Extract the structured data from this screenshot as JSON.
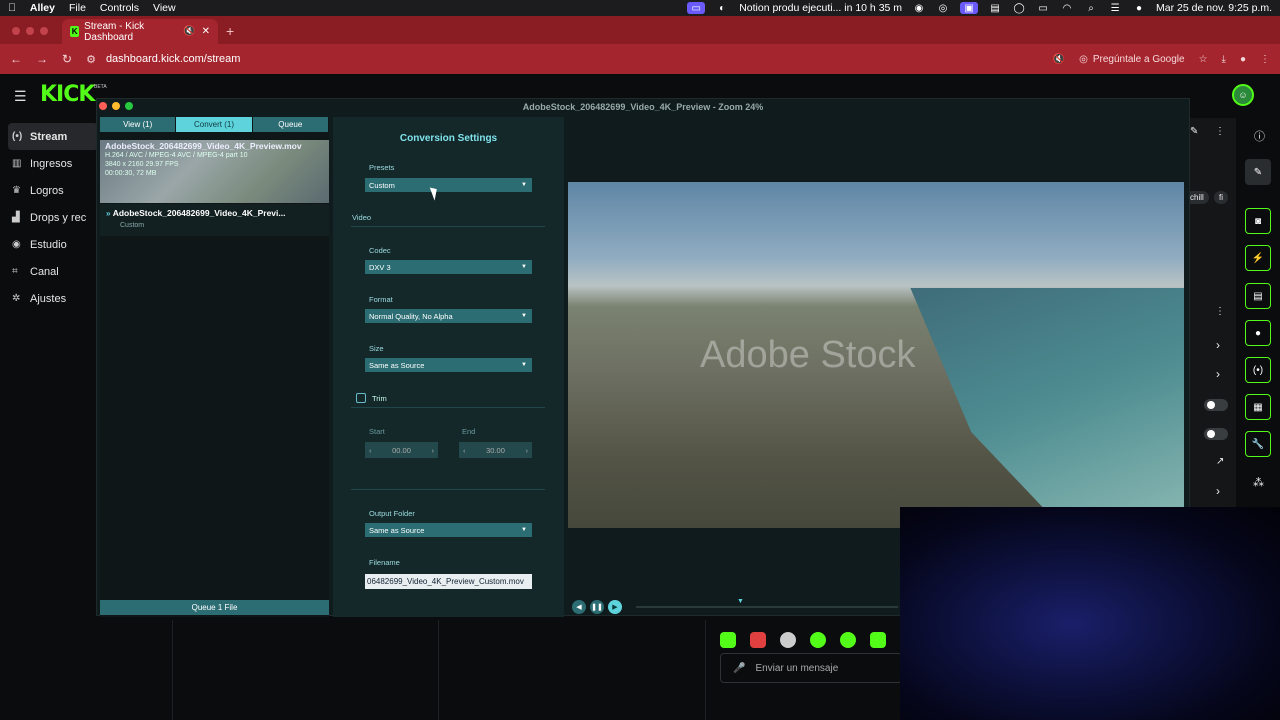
{
  "menubar": {
    "app": "Alley",
    "items": [
      "File",
      "Controls",
      "View"
    ],
    "notion": "Notion produ ejecuti... in 10 h 35 m",
    "datetime": "Mar 25 de nov.  9:25 p.m."
  },
  "browser": {
    "tab_title": "Stream - Kick Dashboard",
    "url": "dashboard.kick.com/stream",
    "google_pill": "Pregúntale a Google"
  },
  "kick": {
    "logo": "KICK",
    "beta": "BETA",
    "nav": [
      {
        "label": "Stream",
        "icon": "broadcast-icon",
        "active": true
      },
      {
        "label": "Ingresos",
        "icon": "chart-icon"
      },
      {
        "label": "Logros",
        "icon": "trophy-icon"
      },
      {
        "label": "Drops y rec",
        "icon": "drops-icon"
      },
      {
        "label": "Estudio",
        "icon": "studio-icon"
      },
      {
        "label": "Canal",
        "icon": "channel-icon"
      },
      {
        "label": "Ajustes",
        "icon": "gear-icon"
      }
    ],
    "chat_placeholder": "Enviar un mensaje",
    "tags": [
      "chill",
      "fi"
    ]
  },
  "app": {
    "window_title": "AdobeStock_206482699_Video_4K_Preview - Zoom 24%",
    "tabs": [
      "View (1)",
      "Convert (1)",
      "Queue"
    ],
    "file": {
      "name": "AdobeStock_206482699_Video_4K_Preview.mov",
      "codec": "H.264 / AVC / MPEG-4 AVC / MPEG-4 part 10",
      "dims": "3840 x 2160 29.97 FPS",
      "meta": "00:00:30, 72 MB"
    },
    "queue_item": {
      "name": "AdobeStock_206482699_Video_4K_Previ...",
      "preset": "Custom"
    },
    "queue_button": "Queue 1 File",
    "settings": {
      "title": "Conversion Settings",
      "presets_label": "Presets",
      "presets_value": "Custom",
      "video_section": "Video",
      "codec_label": "Codec",
      "codec_value": "DXV 3",
      "format_label": "Format",
      "format_value": "Normal Quality, No Alpha",
      "size_label": "Size",
      "size_value": "Same as Source",
      "trim_label": "Trim",
      "start_label": "Start",
      "start_value": "00.00",
      "end_label": "End",
      "end_value": "30.00",
      "output_label": "Output Folder",
      "output_value": "Same as Source",
      "filename_label": "Filename",
      "filename_value": "06482699_Video_4K_Preview_Custom.mov"
    },
    "watermark": "Adobe Stock"
  }
}
